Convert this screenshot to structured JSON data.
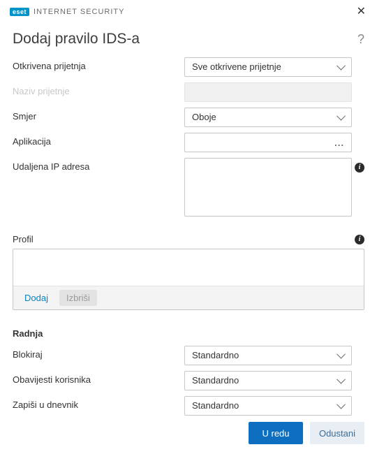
{
  "titlebar": {
    "brand_badge": "eset",
    "brand_text": "INTERNET SECURITY"
  },
  "header": {
    "title": "Dodaj pravilo IDS-a",
    "help": "?"
  },
  "fields": {
    "threat_label": "Otkrivena prijetnja",
    "threat_value": "Sve otkrivene prijetnje",
    "name_label": "Naziv prijetnje",
    "direction_label": "Smjer",
    "direction_value": "Oboje",
    "app_label": "Aplikacija",
    "app_value": "",
    "remote_ip_label": "Udaljena IP adresa",
    "remote_ip_value": ""
  },
  "profile": {
    "label": "Profil",
    "add": "Dodaj",
    "delete": "Izbriši"
  },
  "action_section": {
    "heading": "Radnja",
    "block_label": "Blokiraj",
    "block_value": "Standardno",
    "notify_label": "Obavijesti korisnika",
    "notify_value": "Standardno",
    "log_label": "Zapiši u dnevnik",
    "log_value": "Standardno"
  },
  "footer": {
    "ok": "U redu",
    "cancel": "Odustani"
  }
}
